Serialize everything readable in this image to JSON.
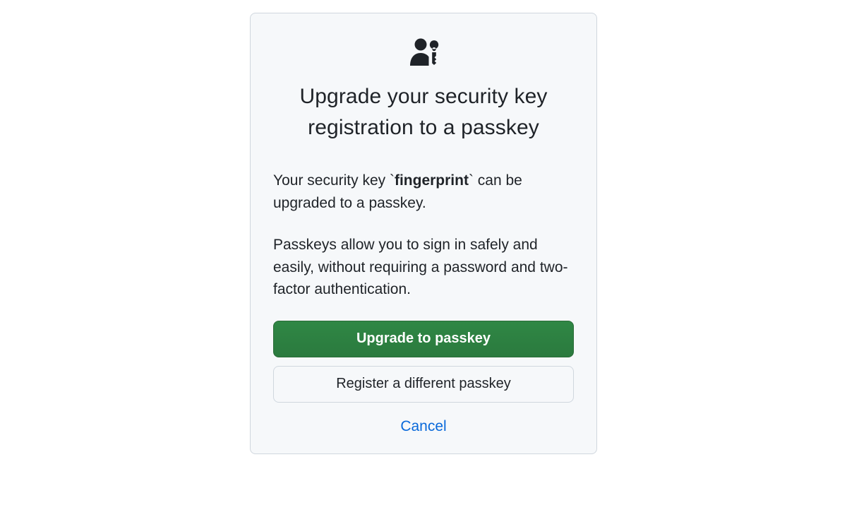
{
  "dialog": {
    "heading": "Upgrade your security key registration to a passkey",
    "body_prefix": "Your security key `",
    "key_name": "fingerprint",
    "body_suffix": "` can be upgraded to a passkey.",
    "body_para2": "Passkeys allow you to sign in safely and easily, without requiring a password and two-factor authentication.",
    "primary_button": "Upgrade to passkey",
    "secondary_button": "Register a different passkey",
    "cancel_link": "Cancel"
  }
}
